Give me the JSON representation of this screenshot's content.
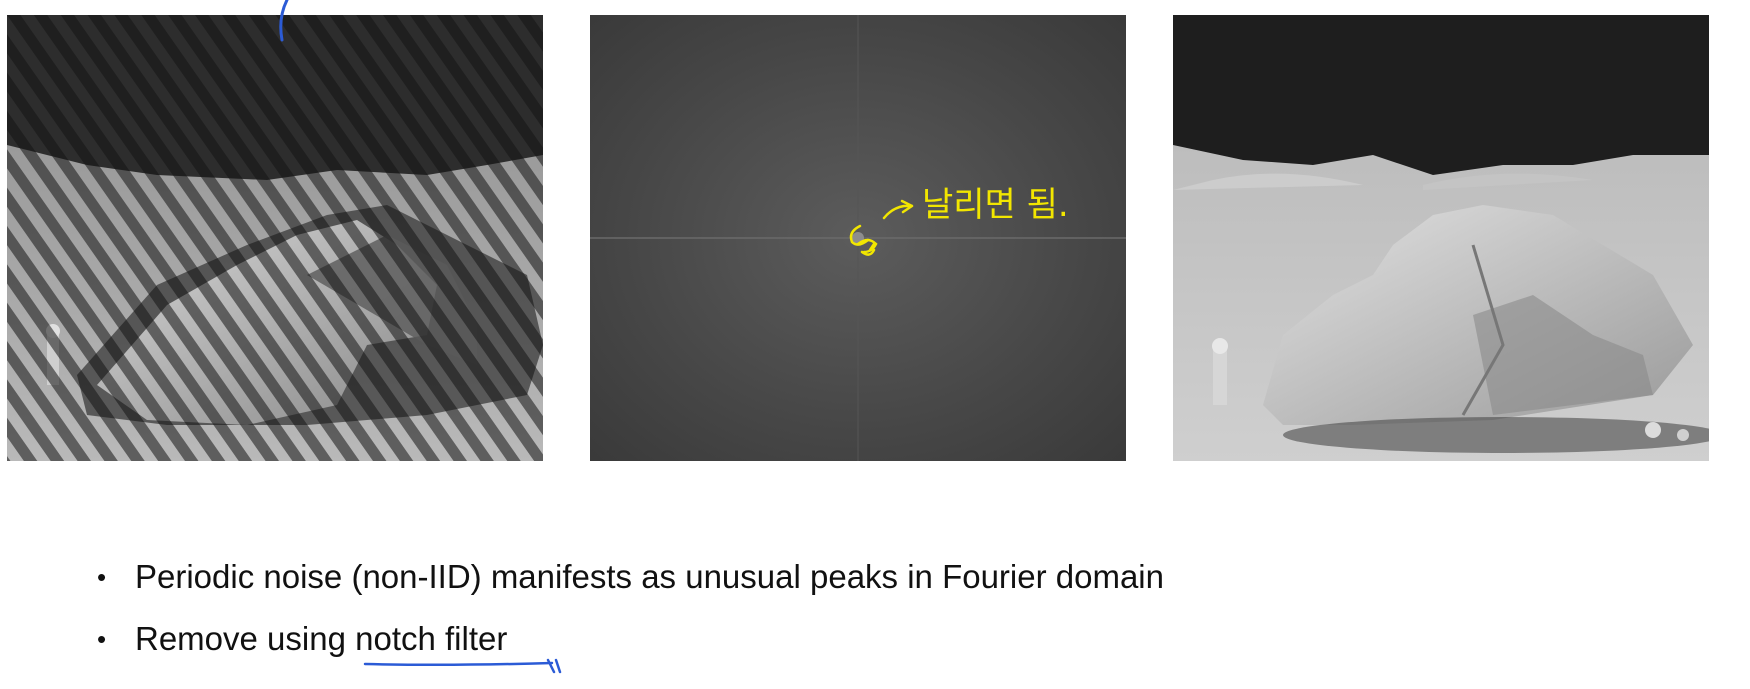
{
  "bullets": [
    {
      "text": "Periodic noise (non-IID) manifests as unusual peaks in Fourier domain"
    },
    {
      "prefix": "Remove using ",
      "highlight": "notch filter"
    }
  ],
  "annotation": {
    "korean_note": "날리면 됨.",
    "ink_color": "#f2e600",
    "pen_color": "#2b5bd6"
  },
  "images": {
    "left": "moon-rock-with-periodic-noise",
    "middle": "fourier-spectrum",
    "right": "moon-rock-restored"
  }
}
